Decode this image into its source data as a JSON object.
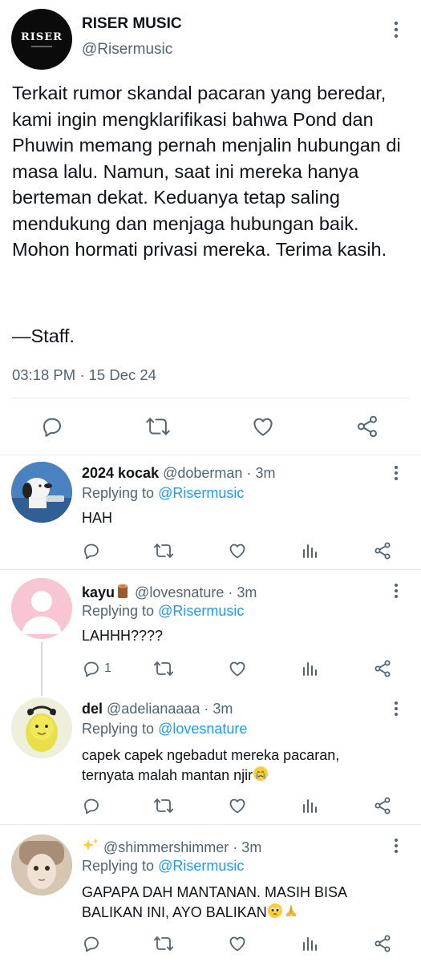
{
  "main_tweet": {
    "display_name": "RISER MUSIC",
    "handle": "@Risermusic",
    "avatar_logo": "RISER",
    "text": "Terkait rumor skandal pacaran yang beredar, kami ingin mengklarifikasi bahwa Pond dan Phuwin memang pernah menjalin hubungan di masa lalu. Namun, saat ini mereka hanya berteman dekat. Keduanya tetap saling mendukung dan menjaga hubungan baik. Mohon hormati privasi mereka. Terima kasih.",
    "signature": "—Staff.",
    "timestamp": "03:18 PM · 15 Dec 24",
    "actions": [
      "reply-icon",
      "retweet-icon",
      "like-icon",
      "share-icon"
    ]
  },
  "replies": [
    {
      "name": "2024 kocak",
      "handle": "@doberman",
      "time": "· 3m",
      "replying_prefix": "Replying to ",
      "replying_to": "@Risermusic",
      "text": "HAH",
      "reply_count": ""
    },
    {
      "name": "kayu",
      "name_emoji": "wood-emoji",
      "handle": "@lovesnature",
      "time": "· 3m",
      "replying_prefix": "Replying to ",
      "replying_to": "@Risermusic",
      "text": "LAHHH????",
      "reply_count": "1"
    },
    {
      "name": "del",
      "handle": "@adelianaaaa",
      "time": "· 3m",
      "replying_prefix": "Replying to ",
      "replying_to": "@lovesnature",
      "text": "capek capek ngebadut mereka pacaran, ternyata malah mantan njir",
      "text_emoji": "crying-face-emoji",
      "reply_count": ""
    },
    {
      "name": "",
      "name_emoji": "sparkles-emoji",
      "handle": "@shimmershimmer",
      "time": "· 3m",
      "replying_prefix": "Replying to ",
      "replying_to": "@Risermusic",
      "text": "GAPAPA DAH MANTANAN. MASIH BISA BALIKAN INI, AYO BALIKAN",
      "text_emoji": "pleading-face-and-folded-hands-emoji",
      "reply_count": ""
    }
  ],
  "colors": {
    "link": "#1d9bf0",
    "secondary_text": "#536471",
    "icon": "#536471",
    "divider": "#e6e9ec"
  }
}
